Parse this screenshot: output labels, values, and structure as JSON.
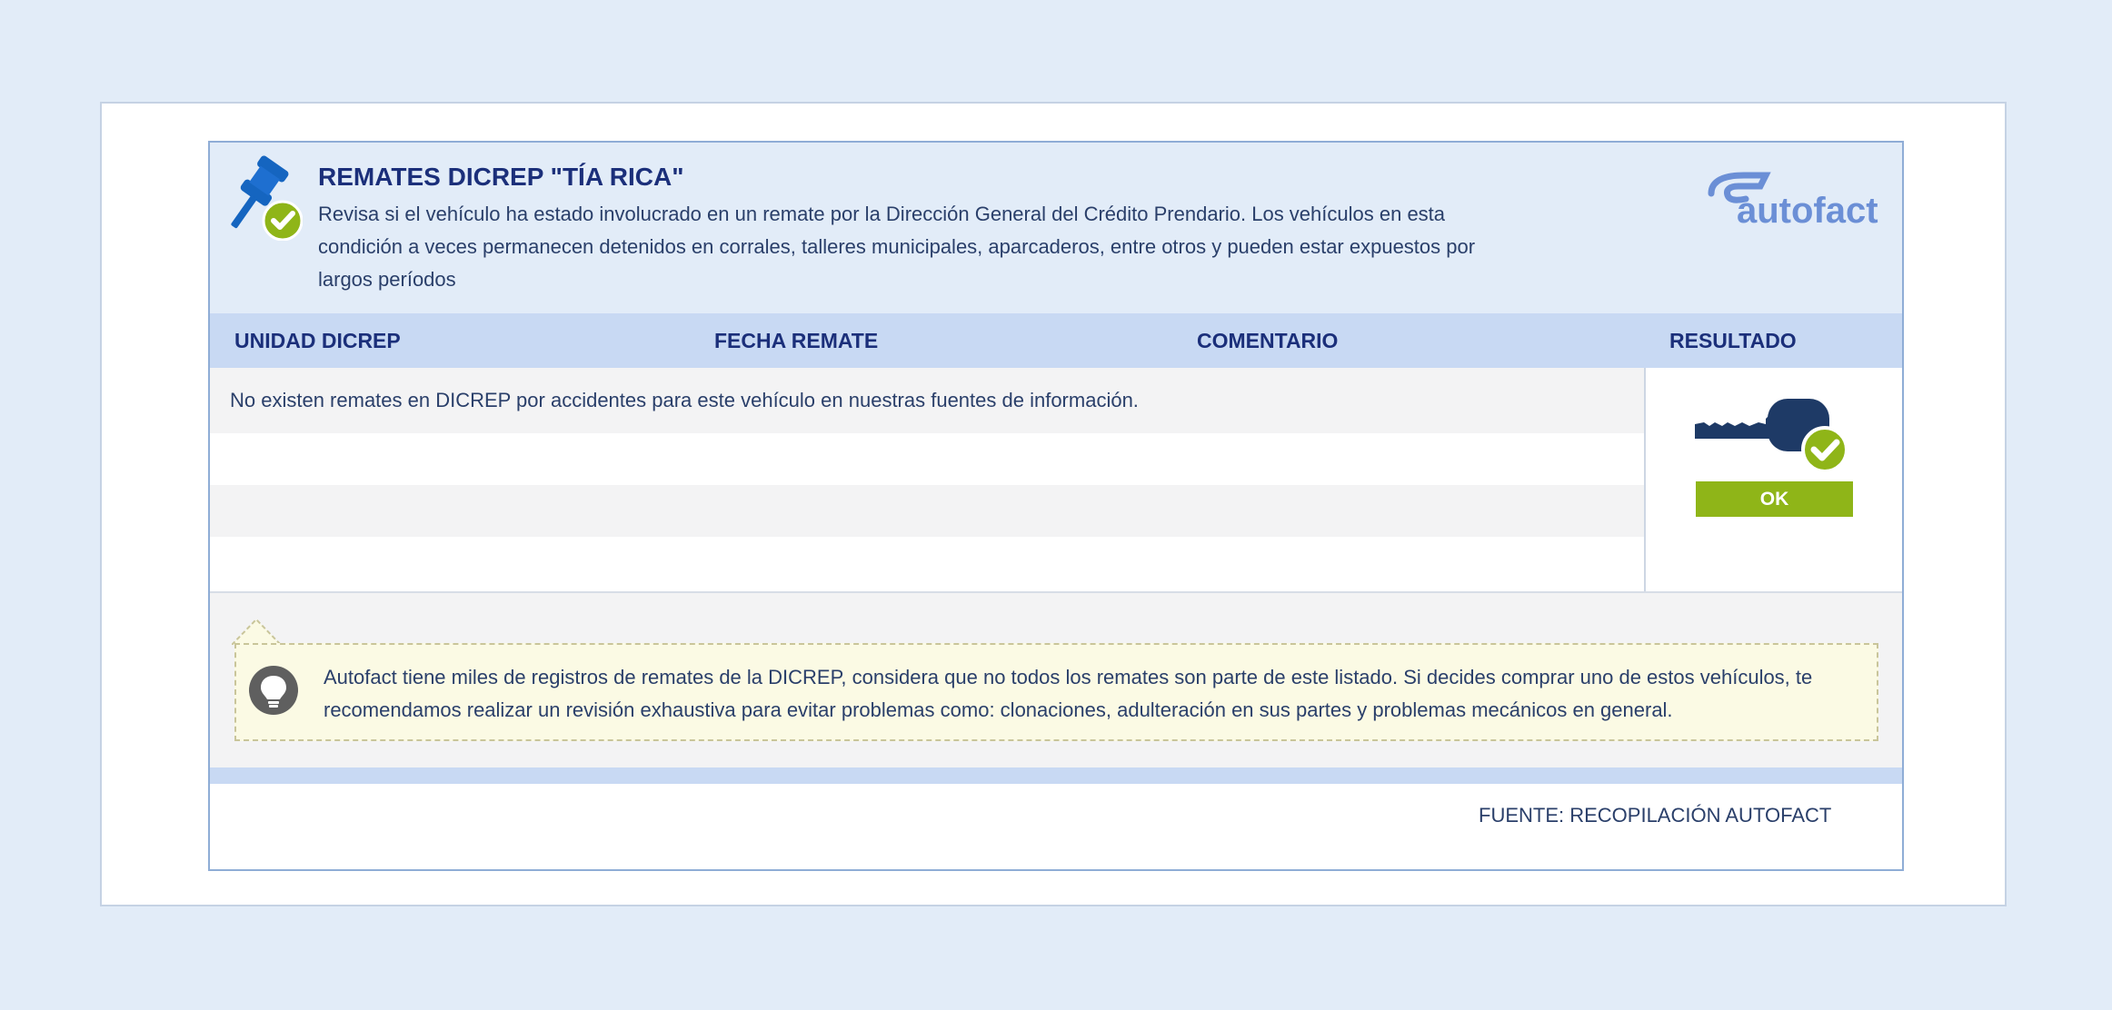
{
  "section": {
    "title": "REMATES DICREP \"TÍA RICA\"",
    "description": "Revisa si el vehículo ha estado involucrado en un remate por la Dirección General del Crédito Prendario. Los vehículos en esta condición a veces permanecen detenidos en corrales, talleres municipales, aparcaderos, entre otros y pueden estar expuestos por largos períodos",
    "logo_text": "autofact"
  },
  "table": {
    "columns": [
      "UNIDAD DICREP",
      "FECHA REMATE",
      "COMENTARIO",
      "RESULTADO"
    ],
    "empty_message": "No existen remates en DICREP por accidentes para este vehículo en nuestras fuentes de información."
  },
  "result": {
    "status_label": "OK"
  },
  "tip": {
    "text": "Autofact tiene miles de registros de remates de la DICREP, considera que no todos los remates son parte de este listado. Si decides comprar uno de estos vehículos, te recomendamos realizar un revisión exhaustiva para evitar problemas como: clonaciones, adulteración en sus partes y problemas mecánicos en general."
  },
  "footer": {
    "source": "FUENTE: RECOPILACIÓN AUTOFACT"
  },
  "icons": {
    "header": "gavel-check-icon",
    "result": "key-check-icon",
    "tip": "lightbulb-icon"
  },
  "colors": {
    "brand_blue": "#1b2f7a",
    "ok_green": "#8fb518",
    "header_bg": "#e2ecf8",
    "table_header_bg": "#c8d9f3",
    "tip_bg": "#fbfae4"
  }
}
